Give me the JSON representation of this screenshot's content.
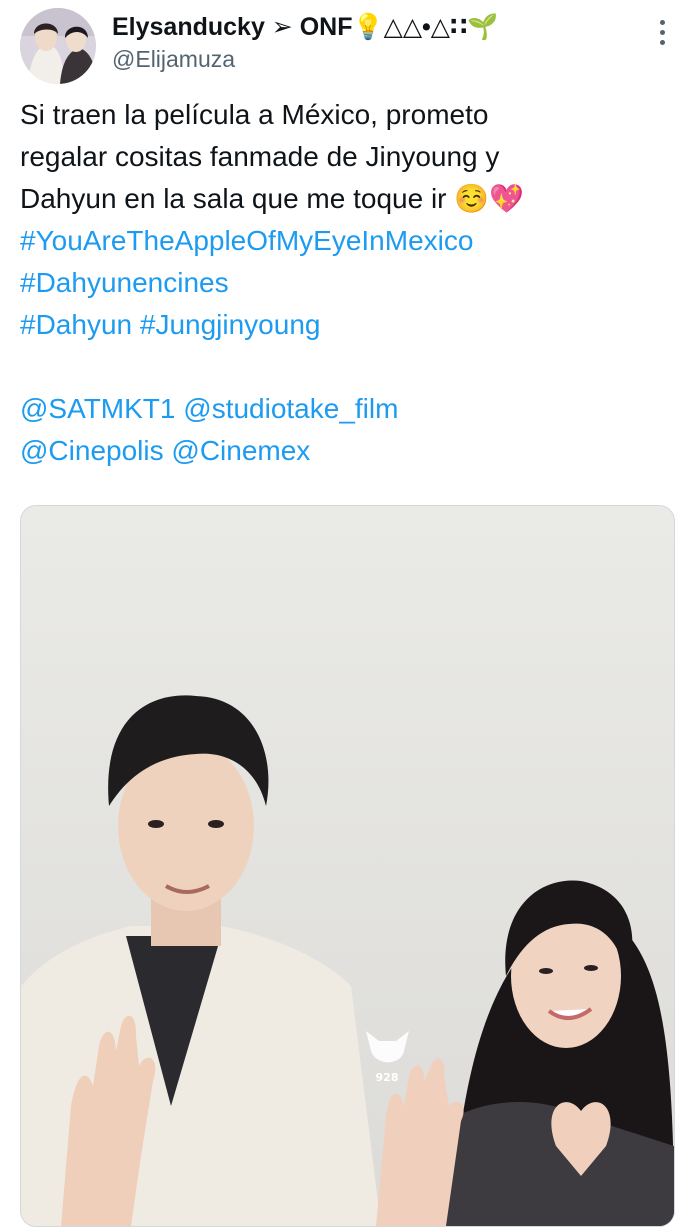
{
  "tweet": {
    "display_name": "Elysanducky ➢ ONF💡△△•△∷🌱",
    "handle": "@Elijamuza",
    "more_icon": "more-dots-icon",
    "text_lines": [
      "Si traen la película a México, prometo",
      "regalar cositas fanmade de Jinyoung y",
      "Dahyun en la sala que me toque ir ☺️💖"
    ],
    "hashtags": {
      "h1": "#YouAreTheAppleOfMyEyeInMexico",
      "h2": "#Dahyunencines",
      "h3": "#Dahyun",
      "h4": "#Jungjinyoung"
    },
    "mentions": {
      "m1": "@SATMKT1",
      "m2": "@studiotake_film",
      "m3": "@Cinepolis",
      "m4": "@Cinemex"
    },
    "media": {
      "watermark": "928"
    }
  }
}
